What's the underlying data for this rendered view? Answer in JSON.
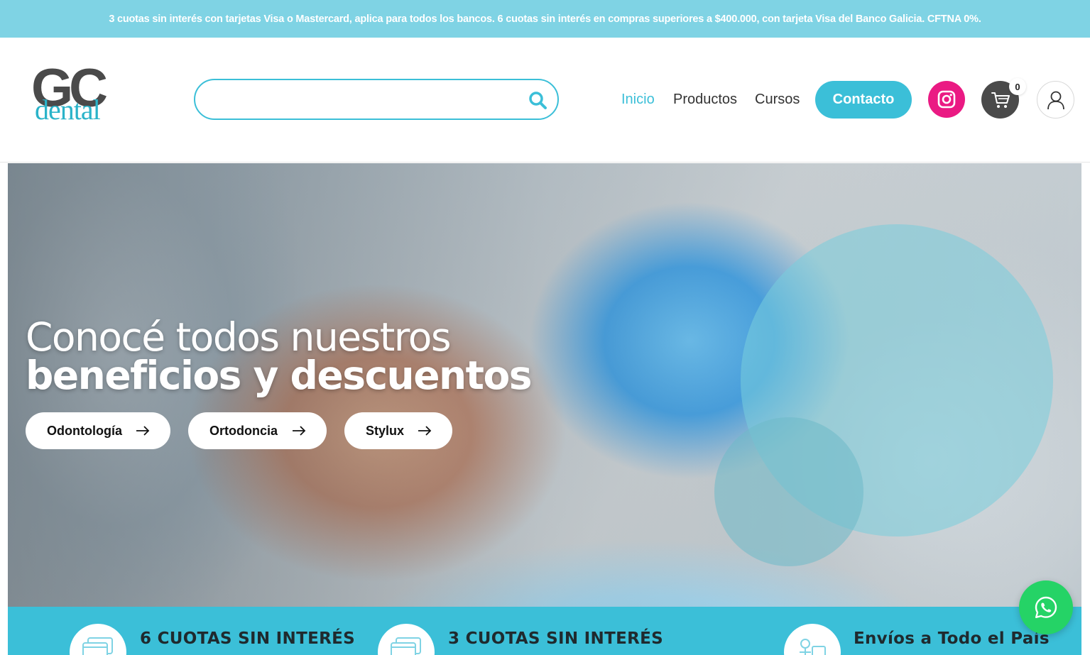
{
  "promo": {
    "text": "3 cuotas sin interés con tarjetas Visa o Mastercard, aplica para todos los bancos. 6 cuotas sin interés en compras superiores a $400.000, con tarjeta Visa del Banco Galicia. CFTNA 0%."
  },
  "brand": {
    "logo_top": "GC",
    "logo_bottom": "dental"
  },
  "search": {
    "value": "",
    "placeholder": ""
  },
  "nav": {
    "items": [
      {
        "label": "Inicio",
        "active": true
      },
      {
        "label": "Productos",
        "active": false
      },
      {
        "label": "Cursos",
        "active": false
      }
    ],
    "contact_label": "Contacto",
    "cart_count": "0"
  },
  "hero": {
    "title_line1": "Conocé todos nuestros",
    "title_line2": "beneficios y descuentos",
    "buttons": [
      {
        "label": "Odontología"
      },
      {
        "label": "Ortodoncia"
      },
      {
        "label": "Stylux"
      }
    ]
  },
  "benefits": [
    {
      "title": "6 CUOTAS SIN INTERÉS",
      "icon": "credit-card-icon"
    },
    {
      "title": "3 CUOTAS SIN INTERÉS",
      "icon": "credit-card-icon"
    },
    {
      "title": "Envíos a Todo el País",
      "icon": "delivery-icon"
    }
  ],
  "colors": {
    "accent": "#3bbfd8",
    "promo_bar": "#7fd3e4",
    "instagram": "#ea1a83",
    "cart": "#4a4a4a",
    "whatsapp": "#25d366",
    "logo_dark": "#4a4a4a"
  }
}
